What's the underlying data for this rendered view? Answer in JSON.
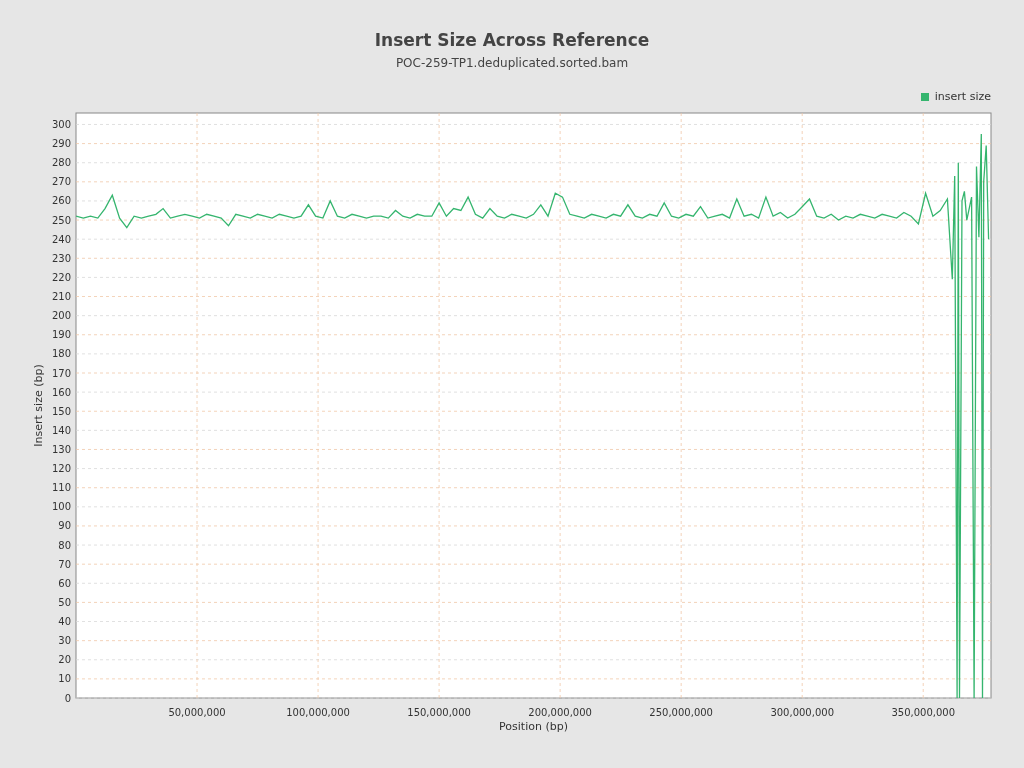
{
  "chart": {
    "title": "Insert Size Across Reference",
    "subtitle": "POC-259-TP1.deduplicated.sorted.bam",
    "chart_data": {
      "type": "line",
      "grid": true,
      "xlabel": "Position (bp)",
      "ylabel": "Insert size (bp)",
      "x": [
        0,
        3000000,
        6000000,
        9000000,
        12000000,
        15000000,
        18000000,
        21000000,
        24000000,
        27000000,
        30000000,
        33000000,
        36000000,
        39000000,
        42000000,
        45000000,
        48000000,
        51000000,
        54000000,
        57000000,
        60000000,
        63000000,
        66000000,
        69000000,
        72000000,
        75000000,
        78000000,
        81000000,
        84000000,
        87000000,
        90000000,
        93000000,
        96000000,
        99000000,
        102000000,
        105000000,
        108000000,
        111000000,
        114000000,
        117000000,
        120000000,
        123000000,
        126000000,
        129000000,
        132000000,
        135000000,
        138000000,
        141000000,
        144000000,
        147000000,
        150000000,
        153000000,
        156000000,
        159000000,
        162000000,
        165000000,
        168000000,
        171000000,
        174000000,
        177000000,
        180000000,
        183000000,
        186000000,
        189000000,
        192000000,
        195000000,
        198000000,
        201000000,
        204000000,
        207000000,
        210000000,
        213000000,
        216000000,
        219000000,
        222000000,
        225000000,
        228000000,
        231000000,
        234000000,
        237000000,
        240000000,
        243000000,
        246000000,
        249000000,
        252000000,
        255000000,
        258000000,
        261000000,
        264000000,
        267000000,
        270000000,
        273000000,
        276000000,
        279000000,
        282000000,
        285000000,
        288000000,
        291000000,
        294000000,
        297000000,
        300000000,
        303000000,
        306000000,
        309000000,
        312000000,
        315000000,
        318000000,
        321000000,
        324000000,
        327000000,
        330000000,
        333000000,
        336000000,
        339000000,
        342000000,
        345000000,
        348000000,
        351000000,
        354000000,
        357000000,
        360000000,
        362000000,
        363000000,
        364000000,
        364500000,
        365000000,
        366000000,
        367000000,
        368000000,
        370000000,
        371000000,
        372000000,
        373000000,
        374000000,
        374500000,
        375000000,
        376000000,
        377000000
      ],
      "series": [
        {
          "name": "insert size",
          "color": "#35b56e",
          "values": [
            252,
            251,
            252,
            251,
            256,
            263,
            251,
            246,
            252,
            251,
            252,
            253,
            256,
            251,
            252,
            253,
            252,
            251,
            253,
            252,
            251,
            247,
            253,
            252,
            251,
            253,
            252,
            251,
            253,
            252,
            251,
            252,
            258,
            252,
            251,
            260,
            252,
            251,
            253,
            252,
            251,
            252,
            252,
            251,
            255,
            252,
            251,
            253,
            252,
            252,
            259,
            252,
            256,
            255,
            262,
            253,
            251,
            256,
            252,
            251,
            253,
            252,
            251,
            253,
            258,
            252,
            264,
            262,
            253,
            252,
            251,
            253,
            252,
            251,
            253,
            252,
            258,
            252,
            251,
            253,
            252,
            259,
            252,
            251,
            253,
            252,
            257,
            251,
            252,
            253,
            251,
            261,
            252,
            253,
            251,
            262,
            252,
            254,
            251,
            253,
            257,
            261,
            252,
            251,
            253,
            250,
            252,
            251,
            253,
            252,
            251,
            253,
            252,
            251,
            254,
            252,
            248,
            264,
            252,
            255,
            261,
            219,
            273,
            0,
            280,
            0,
            260,
            265,
            250,
            262,
            0,
            278,
            241,
            295,
            0,
            270,
            289,
            240
          ]
        }
      ],
      "xlim": [
        0,
        378000000
      ],
      "ylim": [
        0,
        306
      ],
      "xticks": [
        {
          "value": 50000000,
          "label": "50,000,000"
        },
        {
          "value": 100000000,
          "label": "100,000,000"
        },
        {
          "value": 150000000,
          "label": "150,000,000"
        },
        {
          "value": 200000000,
          "label": "200,000,000"
        },
        {
          "value": 250000000,
          "label": "250,000,000"
        },
        {
          "value": 300000000,
          "label": "300,000,000"
        },
        {
          "value": 350000000,
          "label": "350,000,000"
        }
      ],
      "yticks": [
        0,
        10,
        20,
        30,
        40,
        50,
        60,
        70,
        80,
        90,
        100,
        110,
        120,
        130,
        140,
        150,
        160,
        170,
        180,
        190,
        200,
        210,
        220,
        230,
        240,
        250,
        260,
        270,
        280,
        290,
        300
      ]
    }
  }
}
